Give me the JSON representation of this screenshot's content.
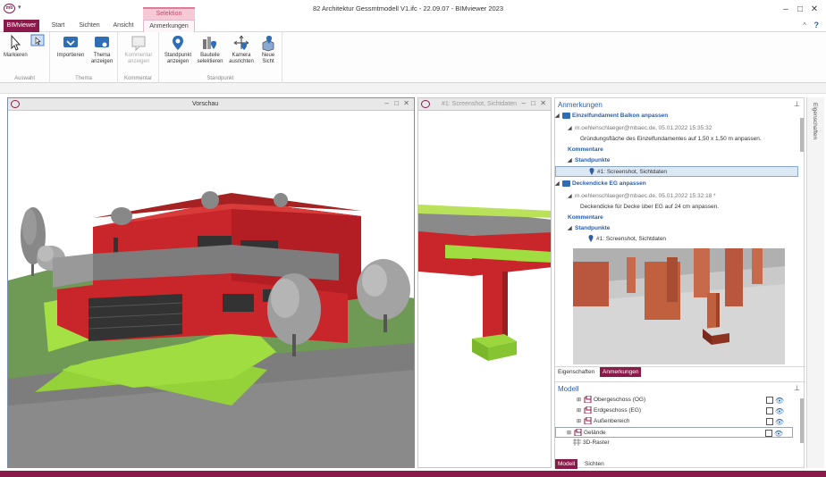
{
  "titlebar": {
    "title": "82 Architektur Gessmtmodell V1.ifc - 22.09.07 - BIMviewer 2023",
    "context_group": "Selektion",
    "quick_access": "▾"
  },
  "tabs": {
    "bimviewer": "BIMviewer",
    "start": "Start",
    "sichten": "Sichten",
    "ansicht": "Ansicht",
    "anmerkungen": "Anmerkungen"
  },
  "ribbon": {
    "groups": {
      "auswahl": "Auswahl",
      "thema": "Thema",
      "kommentar": "Kommentar",
      "standpunkt": "Standpunkt"
    },
    "buttons": {
      "markieren": "Markieren",
      "importieren": "Importieren",
      "thema_anzeigen_1": "Thema",
      "thema_anzeigen_2": "anzeigen",
      "kommentar_anzeigen_1": "Kommentar",
      "kommentar_anzeigen_2": "anzeigen",
      "standpunkt_anzeigen_1": "Standpunkt",
      "standpunkt_anzeigen_2": "anzeigen",
      "bauteile_1": "Bauteile",
      "bauteile_2": "selektieren",
      "kamera_1": "Kamera",
      "kamera_2": "ausrichten",
      "neue_sicht_1": "Neue",
      "neue_sicht_2": "Sicht"
    }
  },
  "windows": {
    "vorschau": "Vorschau",
    "screenshot": "#1: Screenshot, Sichtdaten"
  },
  "anmerkungen": {
    "title": "Anmerkungen",
    "items": [
      {
        "text": "Einzelfundament Balkon anpassen"
      },
      {
        "text": "m.oehlenschlaeger@mbaec.de, 05.01.2022 15:35:32"
      },
      {
        "text": "Gründungsfläche des Einzelfundamentes auf 1,50 x 1,50 m anpassen."
      },
      {
        "text": "Kommentare"
      },
      {
        "text": "Standpunkte"
      },
      {
        "text": "#1: Screenshot, Sichtdaten"
      },
      {
        "text": "Deckendicke EG anpassen"
      },
      {
        "text": "m.oehlenschlaeger@mbaec.de, 05.01.2022 15:32:18 *"
      },
      {
        "text": "Deckendicke für Decke über EG auf 24 cm anpassen."
      },
      {
        "text": "Kommentare"
      },
      {
        "text": "Standpunkte"
      },
      {
        "text": "#1: Screenshot, Sichtdaten"
      }
    ]
  },
  "bottom_tabs_1": {
    "eigenschaften": "Eigenschaften",
    "anmerkungen": "Anmerkungen"
  },
  "modell": {
    "title": "Modell",
    "items": [
      {
        "text": "Obergeschoss (OG)"
      },
      {
        "text": "Erdgeschoss (EG)"
      },
      {
        "text": "Außenbereich"
      },
      {
        "text": "Gelände"
      },
      {
        "text": "3D-Raster"
      }
    ]
  },
  "bottom_tabs_2": {
    "modell": "Modell",
    "sichten": "Sichten"
  },
  "side_panel": {
    "eigenschaften": "Eigenschaften"
  }
}
